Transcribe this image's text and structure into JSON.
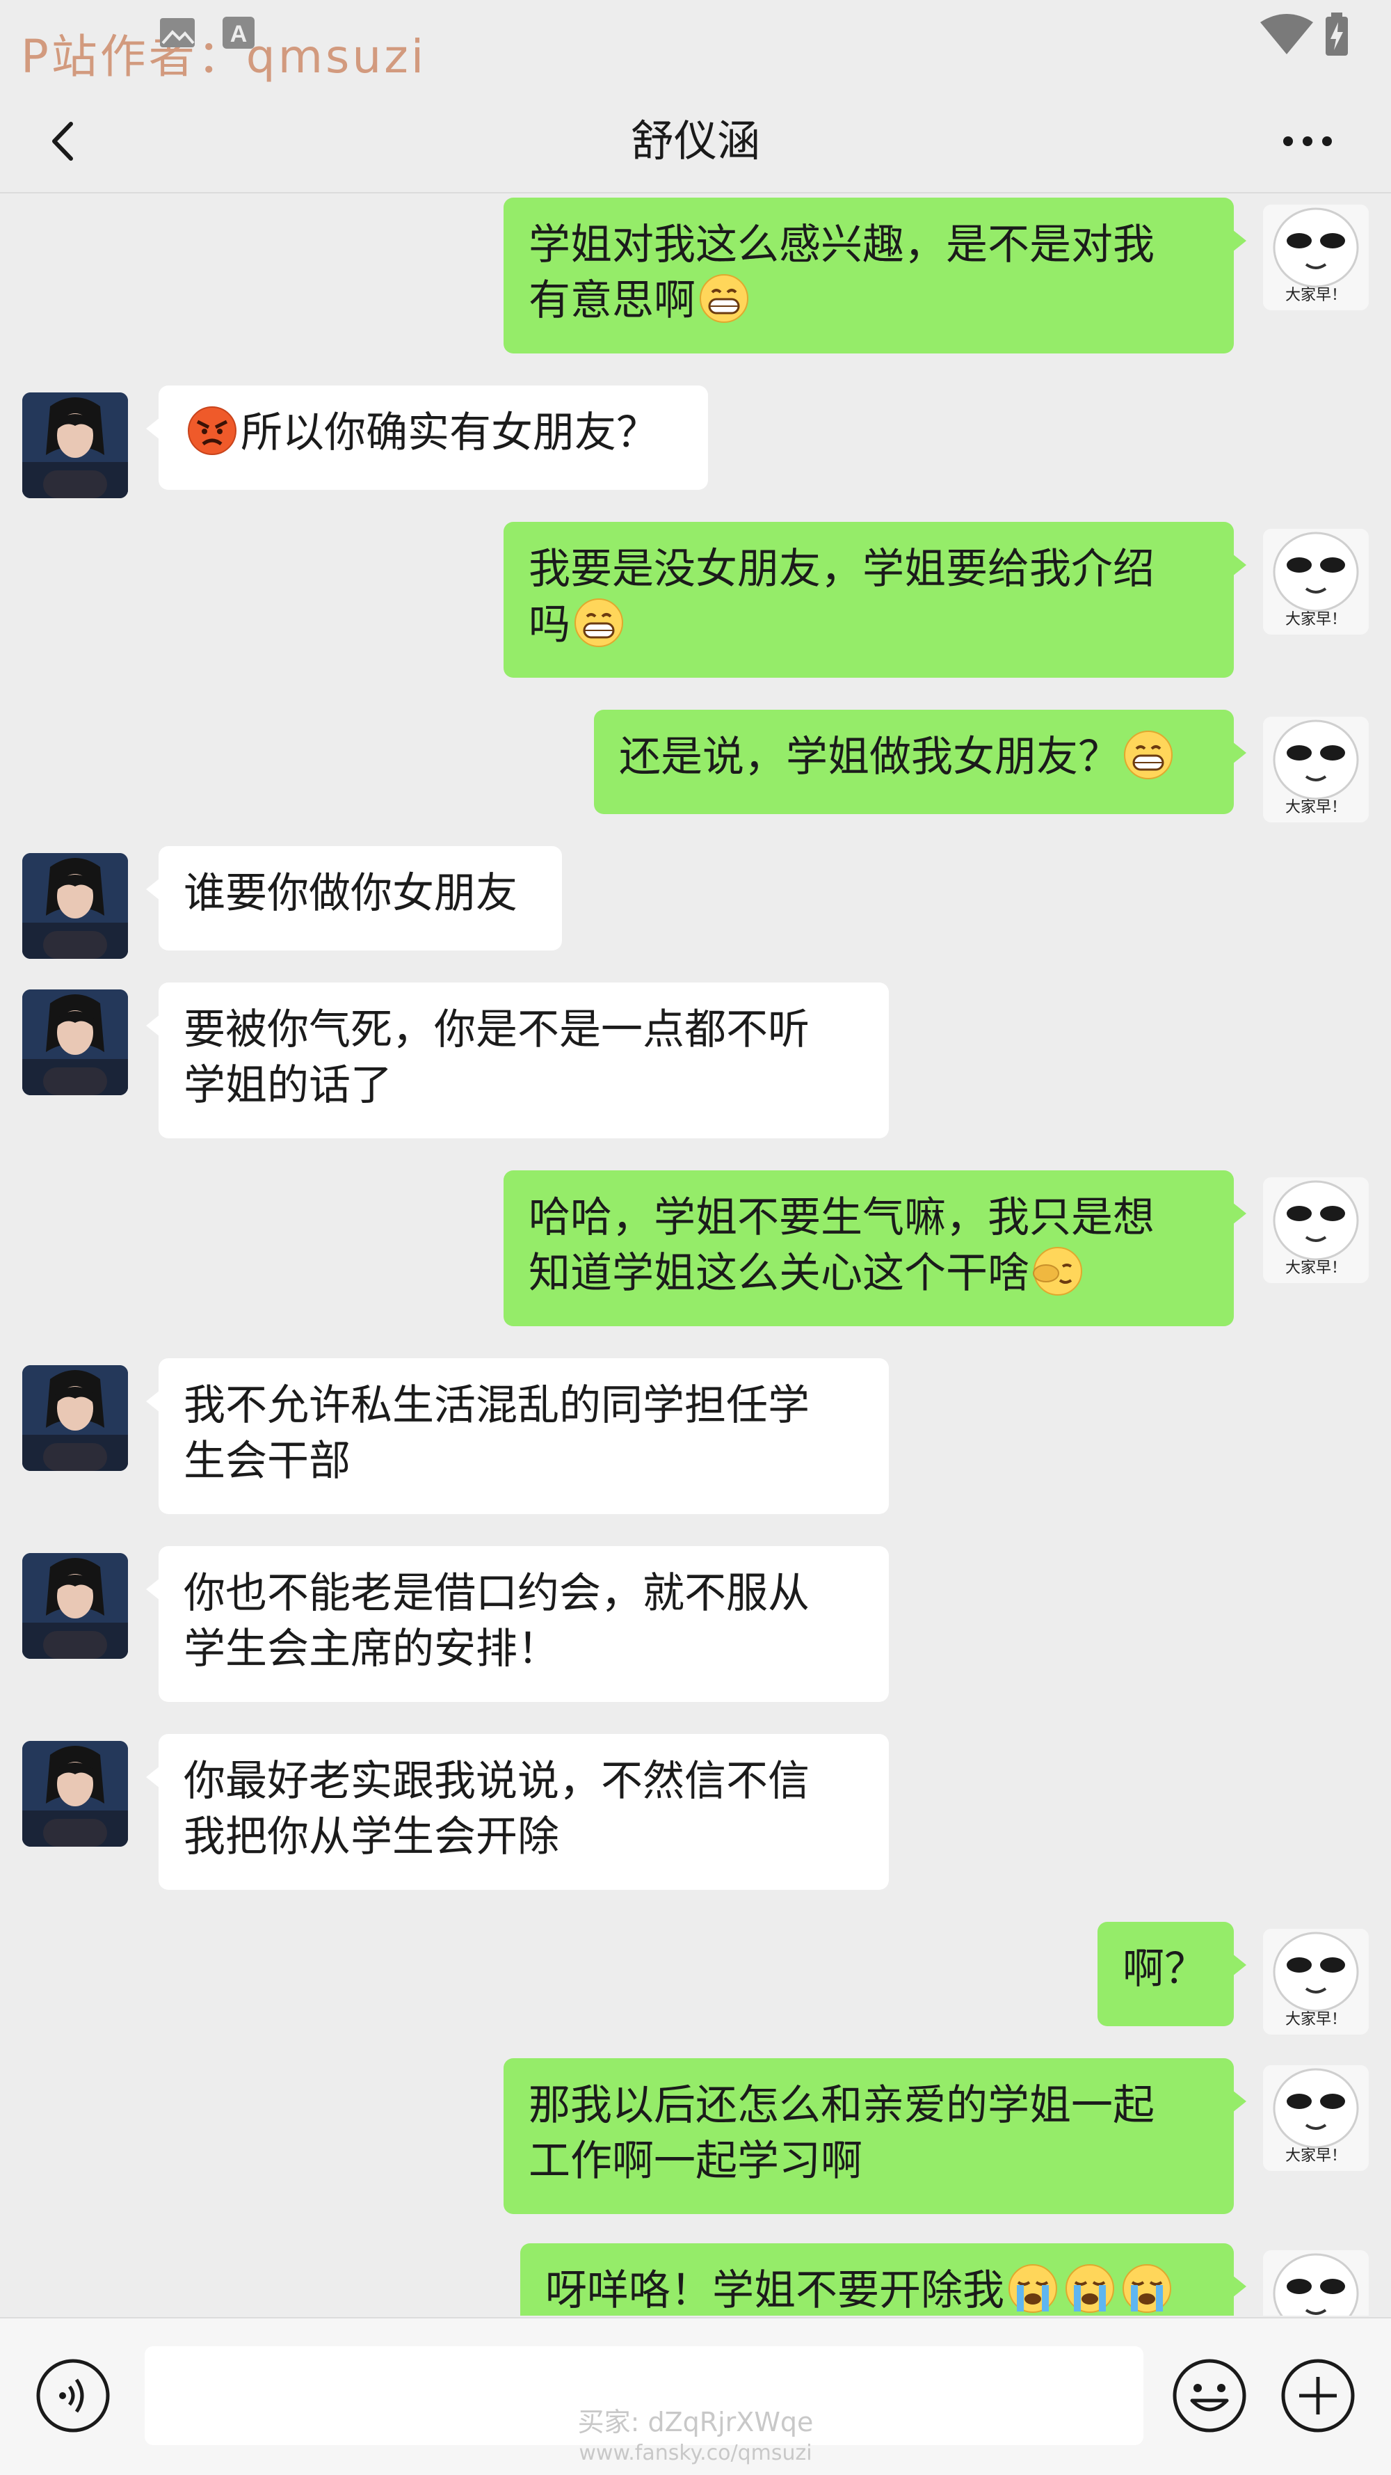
{
  "status_bar": {
    "watermark": "P站作者：qmsuzi",
    "icons": [
      "image-icon",
      "a-badge-icon",
      "wifi-icon",
      "battery-charging-icon"
    ]
  },
  "nav": {
    "title": "舒仪涵",
    "back_icon": "chevron-left-icon",
    "more_icon": "more-dots-icon"
  },
  "avatars": {
    "contact": "girl-portrait-avatar",
    "self": "meme-face-avatar",
    "self_caption": "大家早！"
  },
  "messages": [
    {
      "side": "right",
      "lines": [
        "学姐对我这么感兴趣，是不是对我",
        "有意思啊"
      ],
      "emoji_end": "grin-emoji"
    },
    {
      "side": "left",
      "lines": [
        "所以你确实有女朋友？"
      ],
      "emoji_start": "angry-emoji"
    },
    {
      "side": "right",
      "lines": [
        "我要是没女朋友，学姐要给我介绍",
        "吗"
      ],
      "emoji_end": "grin-emoji"
    },
    {
      "side": "right",
      "lines": [
        "还是说，学姐做我女朋友？"
      ],
      "emoji_end": "grin-emoji"
    },
    {
      "side": "left",
      "lines": [
        "谁要你做你女朋友"
      ]
    },
    {
      "side": "left",
      "lines": [
        "要被你气死，你是不是一点都不听",
        "学姐的话了"
      ]
    },
    {
      "side": "right",
      "lines": [
        "哈哈，学姐不要生气嘛，我只是想",
        "知道学姐这么关心这个干啥"
      ],
      "emoji_end": "facepalm-emoji"
    },
    {
      "side": "left",
      "lines": [
        "我不允许私生活混乱的同学担任学",
        "生会干部"
      ]
    },
    {
      "side": "left",
      "lines": [
        "你也不能老是借口约会，就不服从",
        "学生会主席的安排！"
      ]
    },
    {
      "side": "left",
      "lines": [
        "你最好老实跟我说说，不然信不信",
        "我把你从学生会开除"
      ]
    },
    {
      "side": "right",
      "lines": [
        "啊？"
      ]
    },
    {
      "side": "right",
      "lines": [
        "那我以后还怎么和亲爱的学姐一起",
        "工作啊一起学习啊"
      ]
    },
    {
      "side": "right",
      "lines": [
        "呀咩咯！学姐不要开除我"
      ],
      "emoji_end": "crying-emoji",
      "emoji_count": 3
    }
  ],
  "input_bar": {
    "voice_icon": "voice-icon",
    "emoji_icon": "smiley-icon",
    "plus_icon": "plus-circle-icon",
    "watermark_buyer": "买家: dZqRjrXWqe",
    "watermark_url": "www.fansky.co/qmsuzi"
  },
  "colors": {
    "background": "#ededed",
    "bubble_self": "#95ec69",
    "bubble_other": "#ffffff",
    "watermark_top": "#d29a7e"
  }
}
